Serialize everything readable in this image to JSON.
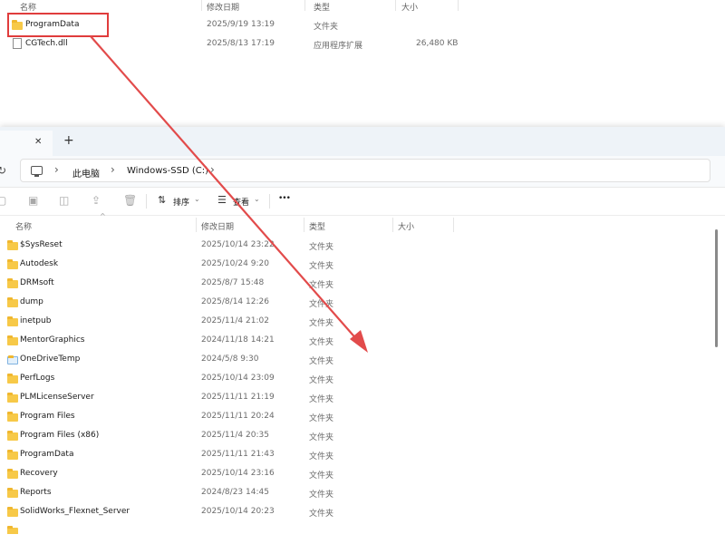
{
  "top_pane": {
    "headers": {
      "name": "名称",
      "date": "修改日期",
      "type": "类型",
      "size": "大小"
    },
    "rows": [
      {
        "name": "ProgramData",
        "date": "2025/9/19 13:19",
        "type": "文件夹",
        "size": "",
        "icon": "folder-icon",
        "highlighted": true
      },
      {
        "name": "CGTech.dll",
        "date": "2025/8/13 17:19",
        "type": "应用程序扩展",
        "size": "26,480 KB",
        "icon": "dll-file-icon",
        "highlighted": false
      }
    ],
    "highlight_color": "#e03c3c"
  },
  "tabbar": {
    "close_symbol": "✕",
    "new_tab_symbol": "+"
  },
  "address_bar": {
    "refresh_symbol": "↻",
    "separator": "›",
    "breadcrumb": [
      "此电脑",
      "Windows-SSD (C:)"
    ]
  },
  "toolbar": {
    "sort_label": "排序",
    "view_label": "查看",
    "more_symbol": "•••"
  },
  "list": {
    "headers": {
      "name": "名称",
      "date": "修改日期",
      "type": "类型",
      "size": "大小"
    },
    "rows": [
      {
        "name": "$SysReset",
        "date": "2025/10/14 23:22",
        "type": "文件夹"
      },
      {
        "name": "Autodesk",
        "date": "2025/10/24 9:20",
        "type": "文件夹"
      },
      {
        "name": "DRMsoft",
        "date": "2025/8/7 15:48",
        "type": "文件夹"
      },
      {
        "name": "dump",
        "date": "2025/8/14 12:26",
        "type": "文件夹"
      },
      {
        "name": "inetpub",
        "date": "2025/11/4 21:02",
        "type": "文件夹"
      },
      {
        "name": "MentorGraphics",
        "date": "2024/11/18 14:21",
        "type": "文件夹"
      },
      {
        "name": "OneDriveTemp",
        "date": "2024/5/8 9:30",
        "type": "文件夹"
      },
      {
        "name": "PerfLogs",
        "date": "2025/10/14 23:09",
        "type": "文件夹"
      },
      {
        "name": "PLMLicenseServer",
        "date": "2025/11/11 21:19",
        "type": "文件夹"
      },
      {
        "name": "Program Files",
        "date": "2025/11/11 20:24",
        "type": "文件夹"
      },
      {
        "name": "Program Files (x86)",
        "date": "2025/11/4 20:35",
        "type": "文件夹"
      },
      {
        "name": "ProgramData",
        "date": "2025/11/11 21:43",
        "type": "文件夹"
      },
      {
        "name": "Recovery",
        "date": "2025/10/14 23:16",
        "type": "文件夹"
      },
      {
        "name": "Reports",
        "date": "2024/8/23 14:45",
        "type": "文件夹"
      },
      {
        "name": "SolidWorks_Flexnet_Server",
        "date": "2025/10/14 20:23",
        "type": "文件夹"
      }
    ]
  },
  "annotation": {
    "color": "#e24b4b"
  }
}
